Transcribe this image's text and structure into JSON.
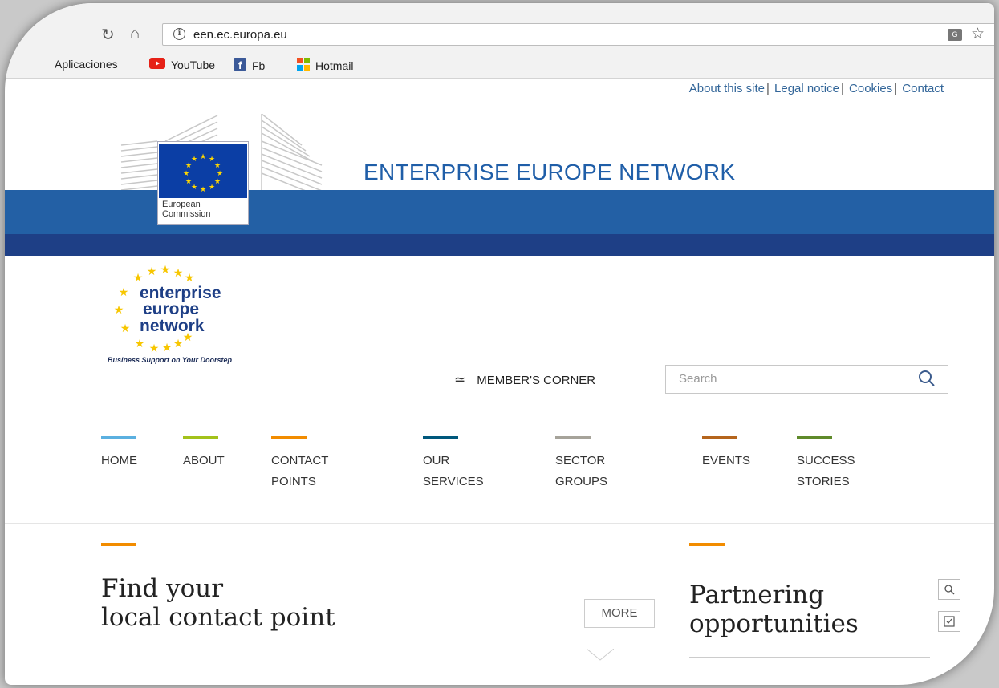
{
  "browser": {
    "url": "een.ec.europa.eu",
    "bookmarks": [
      {
        "label": "Aplicaciones",
        "icon": "apps-icon"
      },
      {
        "label": "YouTube",
        "icon": "youtube-icon"
      },
      {
        "label": "Fb",
        "icon": "facebook-icon"
      },
      {
        "label": "Hotmail",
        "icon": "microsoft-icon"
      }
    ]
  },
  "utility_links": [
    "About this site",
    "Legal notice",
    "Cookies",
    "Contact"
  ],
  "header": {
    "title": "ENTERPRISE EUROPE NETWORK",
    "ec_logo_text": "European Commission",
    "band_color": "#2360a5",
    "band_dark_color": "#1e3f86"
  },
  "een_logo": {
    "line1": "enterprise",
    "line2": "europe",
    "line3": "network",
    "tagline": "Business Support on Your Doorstep"
  },
  "toolbar": {
    "member_corner": "MEMBER'S CORNER",
    "search_placeholder": "Search"
  },
  "nav": [
    {
      "label": "HOME",
      "color": "#5bb0e0"
    },
    {
      "label": "ABOUT",
      "color": "#a3c21b"
    },
    {
      "label": "CONTACT\nPOINTS",
      "color": "#f28c00"
    },
    {
      "label": "OUR\nSERVICES",
      "color": "#00587c"
    },
    {
      "label": "SECTOR\nGROUPS",
      "color": "#a6a39a"
    },
    {
      "label": "EVENTS",
      "color": "#b5651d"
    },
    {
      "label": "SUCCESS\nSTORIES",
      "color": "#5f8a2a"
    }
  ],
  "sections": {
    "contact": {
      "title": "Find your\nlocal contact point",
      "more": "MORE"
    },
    "partnering": {
      "title": "Partnering\nopportunities"
    }
  }
}
